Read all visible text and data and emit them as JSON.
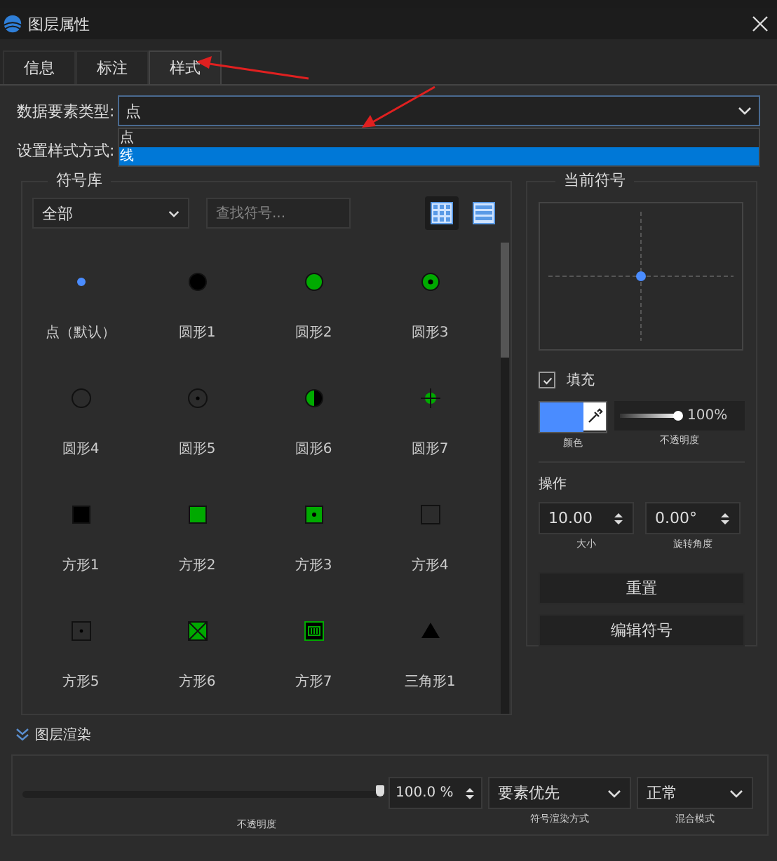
{
  "window": {
    "title": "图层属性"
  },
  "tabs": [
    {
      "label": "信息",
      "selected": false
    },
    {
      "label": "标注",
      "selected": false
    },
    {
      "label": "样式",
      "selected": true
    }
  ],
  "feature_type": {
    "label": "数据要素类型:",
    "value": "点",
    "options": [
      {
        "label": "点",
        "highlighted": false
      },
      {
        "label": "线",
        "highlighted": true
      }
    ]
  },
  "style_mode": {
    "label": "设置样式方式:"
  },
  "symbol_library": {
    "title": "符号库",
    "category": "全部",
    "search": {
      "placeholder": "查找符号..."
    },
    "views": [
      {
        "kind": "grid",
        "selected": true
      },
      {
        "kind": "list",
        "selected": false
      }
    ],
    "symbols": [
      {
        "name": "点（默认）",
        "kind": "dot",
        "color": "#4a8cff"
      },
      {
        "name": "圆形1",
        "kind": "disc",
        "color": "#000000"
      },
      {
        "name": "圆形2",
        "kind": "disc",
        "color": "#00aa00"
      },
      {
        "name": "圆形3",
        "kind": "disc-dot",
        "color": "#00aa00"
      },
      {
        "name": "圆形4",
        "kind": "ring",
        "color": "#111111"
      },
      {
        "name": "圆形5",
        "kind": "ring-dot",
        "color": "#111111"
      },
      {
        "name": "圆形6",
        "kind": "half-disc",
        "color": "#00aa00"
      },
      {
        "name": "圆形7",
        "kind": "crosshair",
        "color": "#00aa00"
      },
      {
        "name": "方形1",
        "kind": "square",
        "color": "#000000"
      },
      {
        "name": "方形2",
        "kind": "square",
        "color": "#00aa00"
      },
      {
        "name": "方形3",
        "kind": "square-dot",
        "color": "#00aa00"
      },
      {
        "name": "方形4",
        "kind": "square-outline",
        "color": "#111111"
      },
      {
        "name": "方形5",
        "kind": "square-outline-dot",
        "color": "#111111"
      },
      {
        "name": "方形6",
        "kind": "square-cross",
        "color": "#00aa00"
      },
      {
        "name": "方形7",
        "kind": "square-framed",
        "color": "#00aa00"
      },
      {
        "name": "三角形1",
        "kind": "triangle",
        "color": "#000000"
      }
    ]
  },
  "current_symbol": {
    "title": "当前符号",
    "color": "#4a8cff",
    "fill": {
      "label": "填充",
      "checked": true
    },
    "color_label": "颜色",
    "opacity": {
      "level": 1,
      "reading": "100%",
      "label": "不透明度"
    },
    "operations_title": "操作",
    "size": {
      "value": "10.00",
      "label": "大小"
    },
    "rotation": {
      "value": "0.00°",
      "label": "旋转角度"
    },
    "buttons": [
      "重置",
      "编辑符号"
    ]
  },
  "layer_render": {
    "title": "图层渲染",
    "expanded": true,
    "opacity": {
      "level": 1,
      "value": "100.0 %",
      "label": "不透明度"
    },
    "render_mode": {
      "value": "要素优先",
      "label": "符号渲染方式"
    },
    "blend_mode": {
      "value": "正常",
      "label": "混合模式"
    }
  }
}
